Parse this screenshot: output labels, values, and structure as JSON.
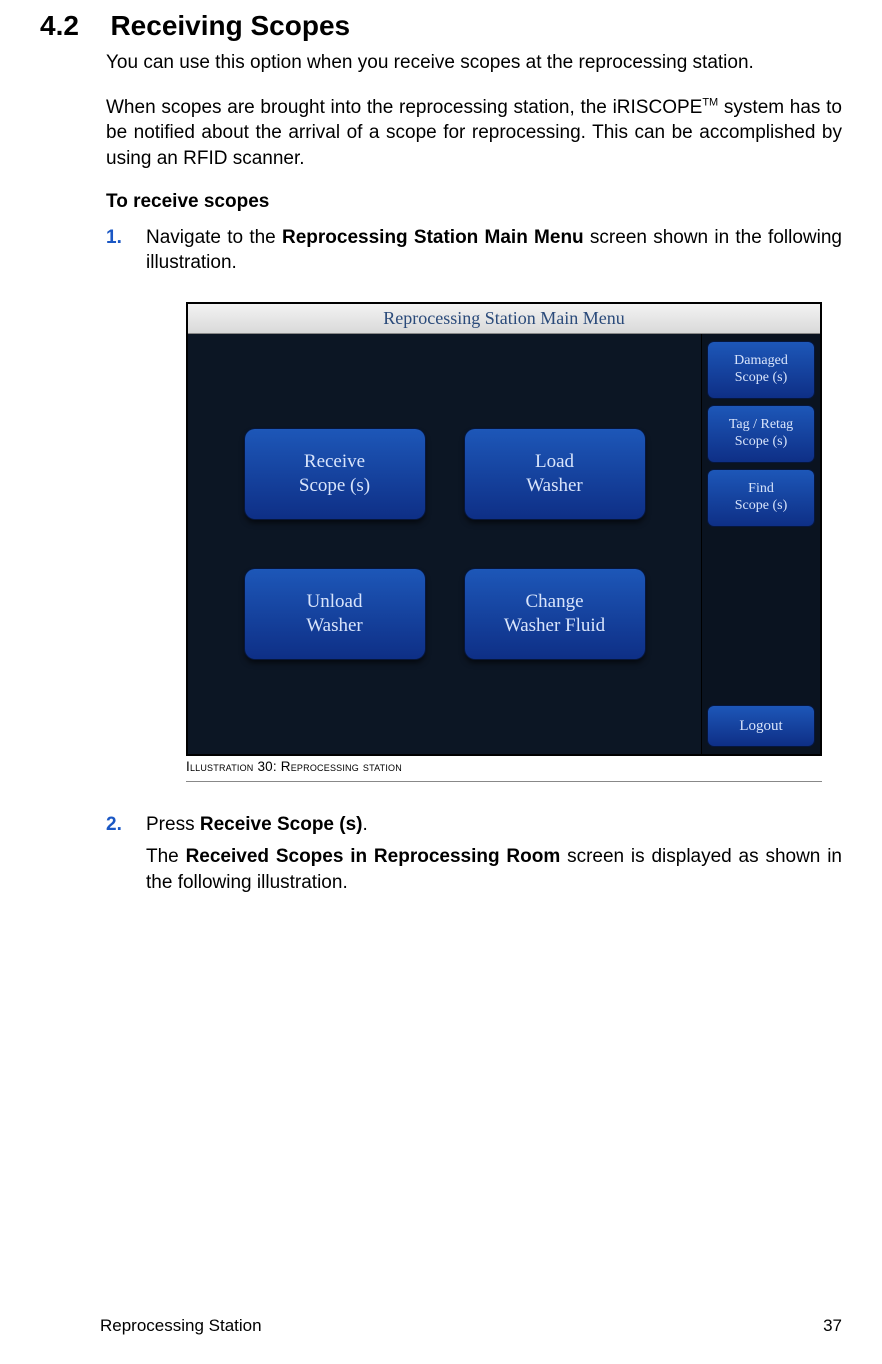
{
  "section": {
    "number": "4.2",
    "title": "Receiving Scopes"
  },
  "para1": "You can use this option when you receive scopes at the reprocessing station.",
  "para2_pre": "When scopes are brought into the reprocessing station, the  iRISCOPE",
  "para2_tm": "TM",
  "para2_post": " system has to be notified about the arrival of a scope for reprocessing. This can be accomplished by using an RFID scanner.",
  "subhead": "To receive scopes",
  "steps": {
    "s1": {
      "num": "1.",
      "pre": "Navigate to the ",
      "bold": "Reprocessing Station Main Menu",
      "post": " screen shown in the following illustration."
    },
    "s2": {
      "num": "2.",
      "pre": "Press ",
      "bold": "Receive Scope (s)",
      "post": ".",
      "follow_pre": "The ",
      "follow_bold": "Received Scopes in Reprocessing Room",
      "follow_post": " screen is displayed as shown in the following illustration."
    }
  },
  "device": {
    "title": "Reprocessing Station Main Menu",
    "main_buttons": {
      "receive": "Receive\nScope (s)",
      "load": "Load\nWasher",
      "unload": "Unload\nWasher",
      "change": "Change\nWasher Fluid"
    },
    "side_buttons": {
      "damaged": "Damaged\nScope (s)",
      "tag": "Tag / Retag\nScope (s)",
      "find": "Find\nScope (s)",
      "logout": "Logout"
    }
  },
  "caption": {
    "label": "Illustration",
    "num": "30",
    "sep": ":",
    "text": "Reprocessing station"
  },
  "footer": {
    "left": "Reprocessing Station",
    "right": "37"
  }
}
